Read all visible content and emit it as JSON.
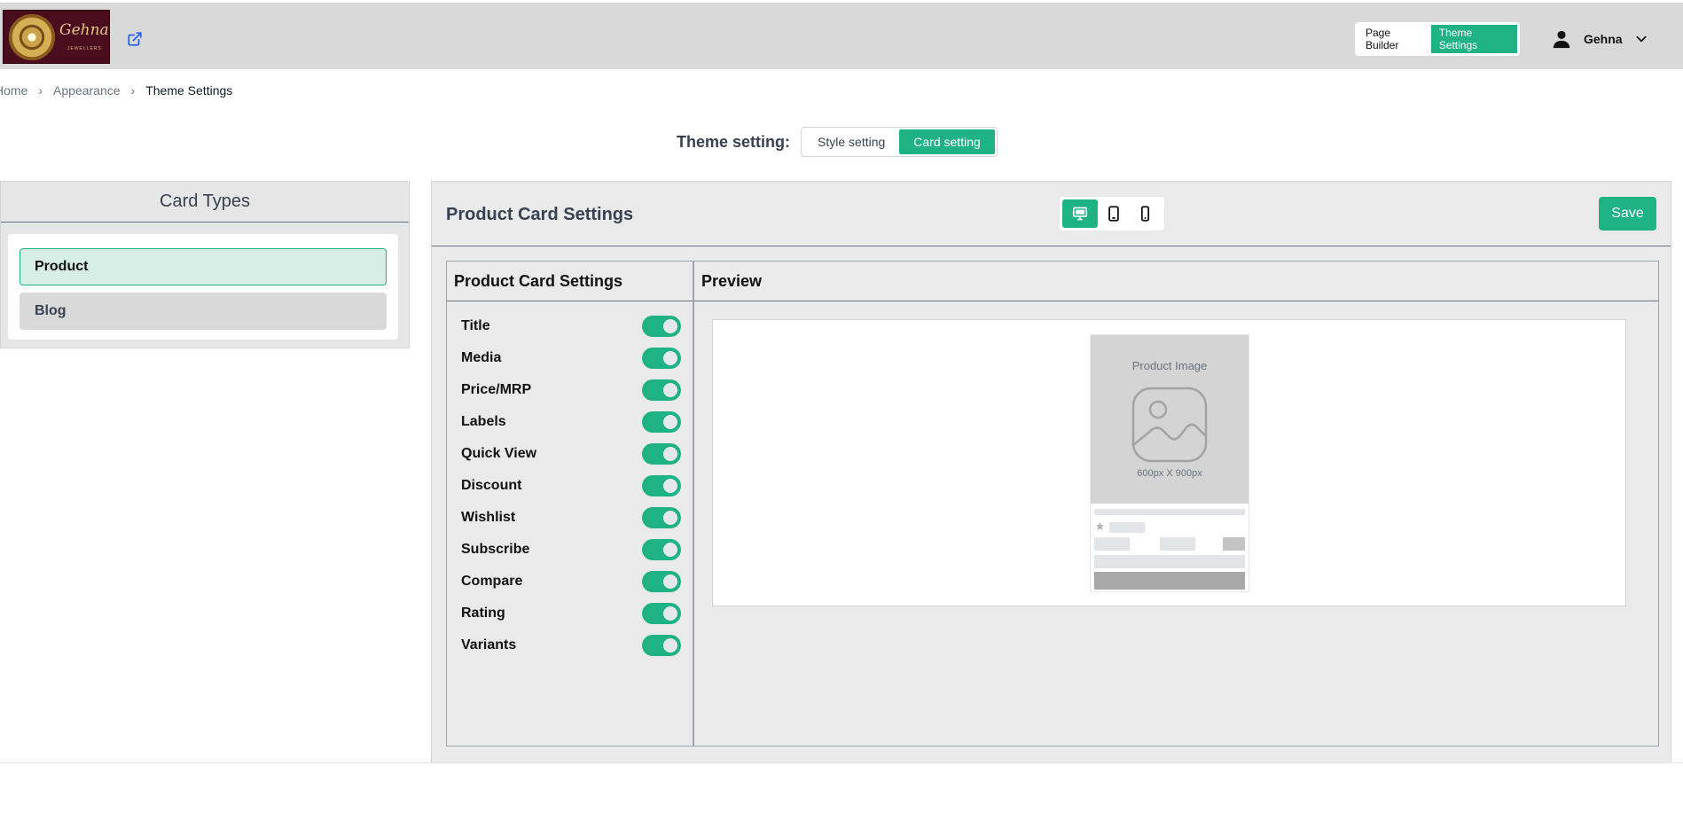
{
  "header": {
    "brand_name": "Gehna",
    "brand_sub": "JEWELLERS",
    "external_link_icon": "external-link-icon",
    "mode_switch": {
      "page_builder": "Page Builder",
      "theme_settings": "Theme Settings",
      "active": "Theme Settings"
    },
    "user": {
      "name": "Gehna",
      "icon": "user-icon",
      "menu_icon": "chevron-down-icon"
    }
  },
  "breadcrumb": [
    "Home",
    "Appearance",
    "Theme Settings"
  ],
  "theme_setting": {
    "label": "Theme setting:",
    "options": [
      "Style setting",
      "Card setting"
    ],
    "active": "Card setting"
  },
  "card_types": {
    "title": "Card Types",
    "items": [
      "Product",
      "Blog"
    ],
    "active": "Product"
  },
  "product_card": {
    "title": "Product Card Settings",
    "devices": [
      {
        "name": "desktop-icon",
        "active": true
      },
      {
        "name": "tablet-icon",
        "active": false
      },
      {
        "name": "mobile-icon",
        "active": false
      }
    ],
    "save_label": "Save",
    "settings_header": "Product Card Settings",
    "toggles": [
      {
        "label": "Title",
        "on": true
      },
      {
        "label": "Media",
        "on": true
      },
      {
        "label": "Price/MRP",
        "on": true
      },
      {
        "label": "Labels",
        "on": true
      },
      {
        "label": "Quick View",
        "on": true
      },
      {
        "label": "Discount",
        "on": true
      },
      {
        "label": "Wishlist",
        "on": true
      },
      {
        "label": "Subscribe",
        "on": true
      },
      {
        "label": "Compare",
        "on": true
      },
      {
        "label": "Rating",
        "on": true
      },
      {
        "label": "Variants",
        "on": true
      }
    ],
    "preview_header": "Preview",
    "preview": {
      "image_title": "Product Image",
      "image_size": "600px X 900px",
      "image_icon": "image-placeholder-icon"
    }
  },
  "colors": {
    "accent": "#1fb383",
    "header_bg": "#d9d9d9",
    "panel_bg": "#eaeaea"
  }
}
